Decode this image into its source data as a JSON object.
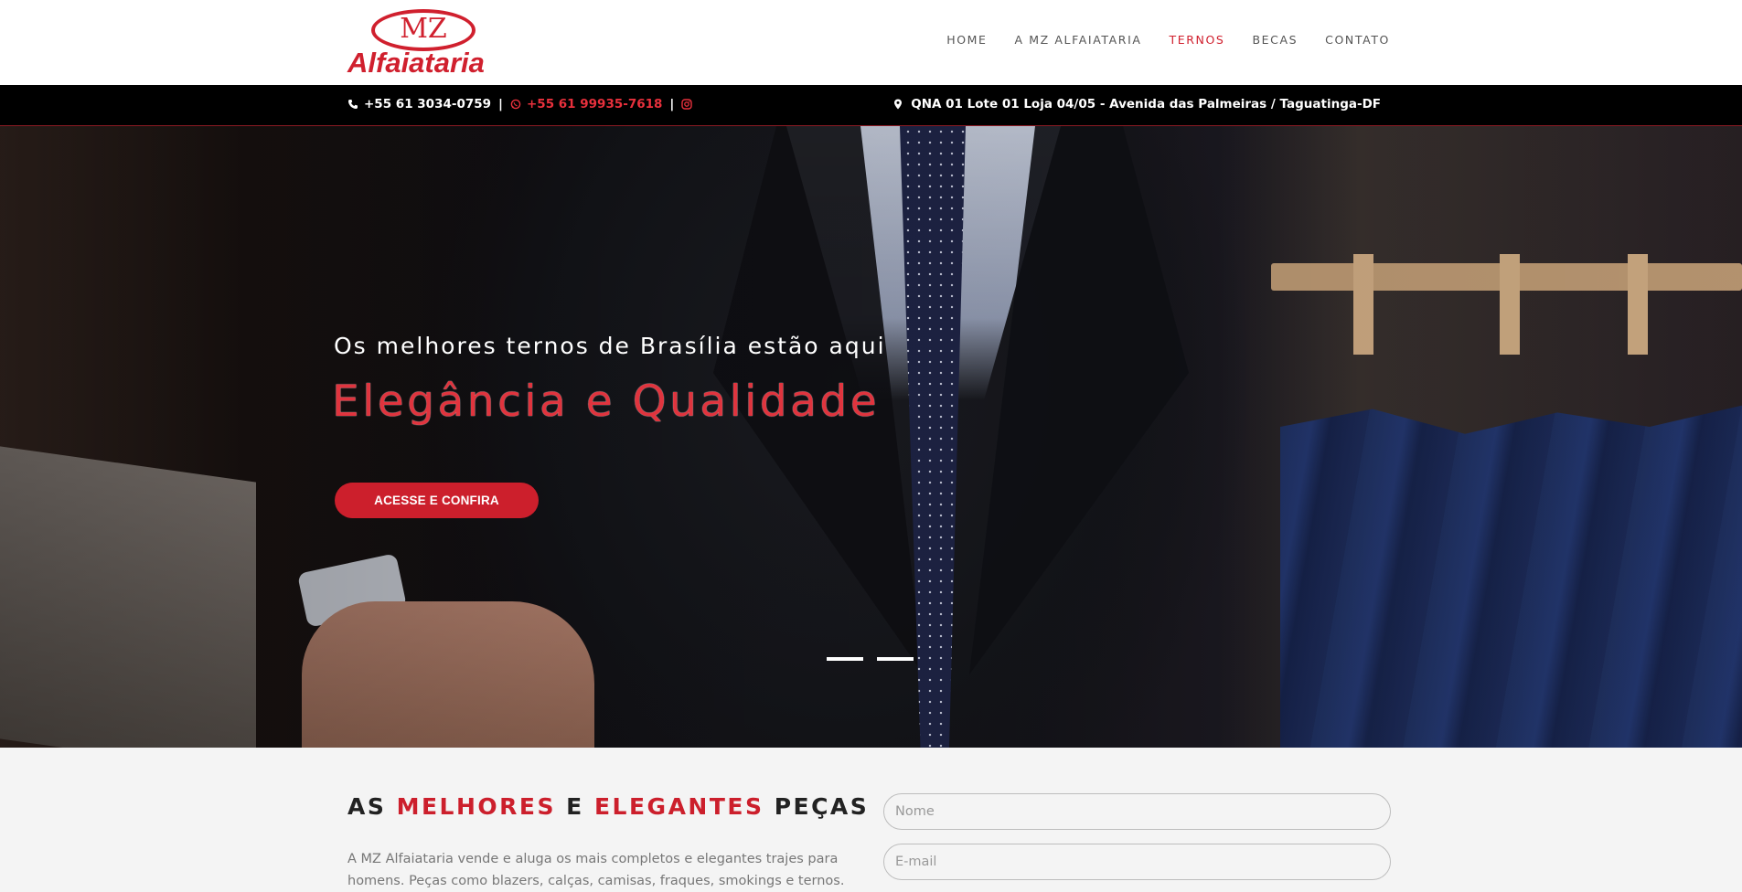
{
  "brand": {
    "logo_mz": "MZ",
    "logo_name": "Alfaiataria"
  },
  "nav": {
    "items": [
      {
        "label": "HOME"
      },
      {
        "label": "A MZ ALFAIATARIA"
      },
      {
        "label": "TERNOS"
      },
      {
        "label": "BECAS"
      },
      {
        "label": "CONTATO"
      }
    ],
    "active_index": 2
  },
  "topbar": {
    "phone": "+55 61 3034-0759",
    "whatsapp": "+55 61 99935-7618",
    "separator": "|",
    "address": "QNA 01 Lote 01 Loja 04/05 - Avenida das Palmeiras / Taguatinga-DF",
    "icons": [
      "phone-icon",
      "whatsapp-icon",
      "instagram-icon",
      "map-marker-icon"
    ]
  },
  "hero": {
    "subtitle": "Os melhores ternos de Brasília estão aqui",
    "title": "Elegância e Qualidade",
    "button_label": "ACESSE E CONFIRA",
    "slide_count": 2
  },
  "section": {
    "title_parts": [
      "AS ",
      "MELHORES",
      " E ",
      "ELEGANTES",
      " PEÇAS"
    ],
    "text": "A MZ Alfaiataria vende e aluga os mais completos e elegantes trajes para homens. Peças como blazers, calças, camisas, fraques, smokings e ternos."
  },
  "form": {
    "name_placeholder": "Nome",
    "email_placeholder": "E-mail"
  },
  "colors": {
    "accent": "#cc1f2c",
    "topbar_bg": "#000000",
    "header_bg": "#ffffff",
    "section_bg": "#f4f4f4"
  }
}
